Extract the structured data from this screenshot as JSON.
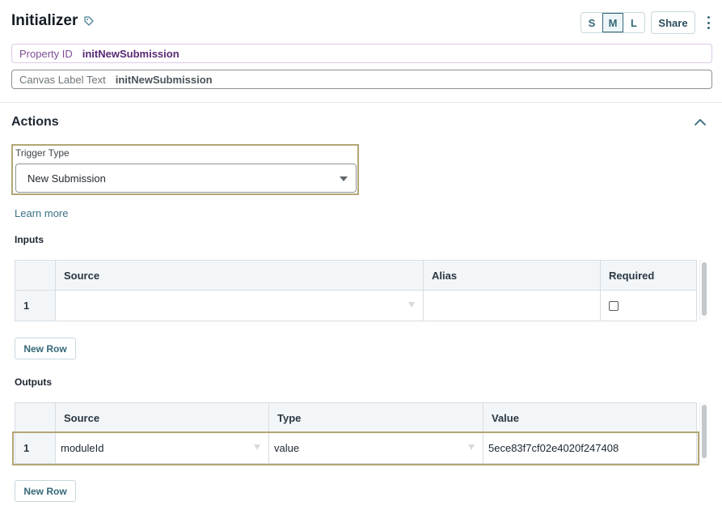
{
  "header": {
    "title": "Initializer",
    "title_icon": "tag-icon",
    "size_options": [
      "S",
      "M",
      "L"
    ],
    "size_selected": "M",
    "share_label": "Share",
    "menu_icon": "kebab-menu-icon"
  },
  "property_id": {
    "label": "Property ID",
    "value": "initNewSubmission"
  },
  "canvas_label": {
    "label": "Canvas Label Text",
    "value": "initNewSubmission"
  },
  "actions": {
    "title": "Actions",
    "collapse_icon": "chevron-up-icon",
    "trigger_type": {
      "label": "Trigger Type",
      "value": "New Submission"
    },
    "learn_more": "Learn more",
    "inputs": {
      "title": "Inputs",
      "columns": [
        "Source",
        "Alias",
        "Required"
      ],
      "rows": [
        {
          "index": "1",
          "source": "",
          "alias": "",
          "required": false
        }
      ],
      "new_row_label": "New Row"
    },
    "outputs": {
      "title": "Outputs",
      "columns": [
        "Source",
        "Type",
        "Value"
      ],
      "rows": [
        {
          "index": "1",
          "source": "moduleId",
          "type": "value",
          "value": "5ece83f7cf02e4020f247408"
        }
      ],
      "new_row_label": "New Row"
    }
  },
  "colors": {
    "accent": "#356878",
    "highlight_border": "#b3a676",
    "property_id_text": "#5a2a73"
  }
}
